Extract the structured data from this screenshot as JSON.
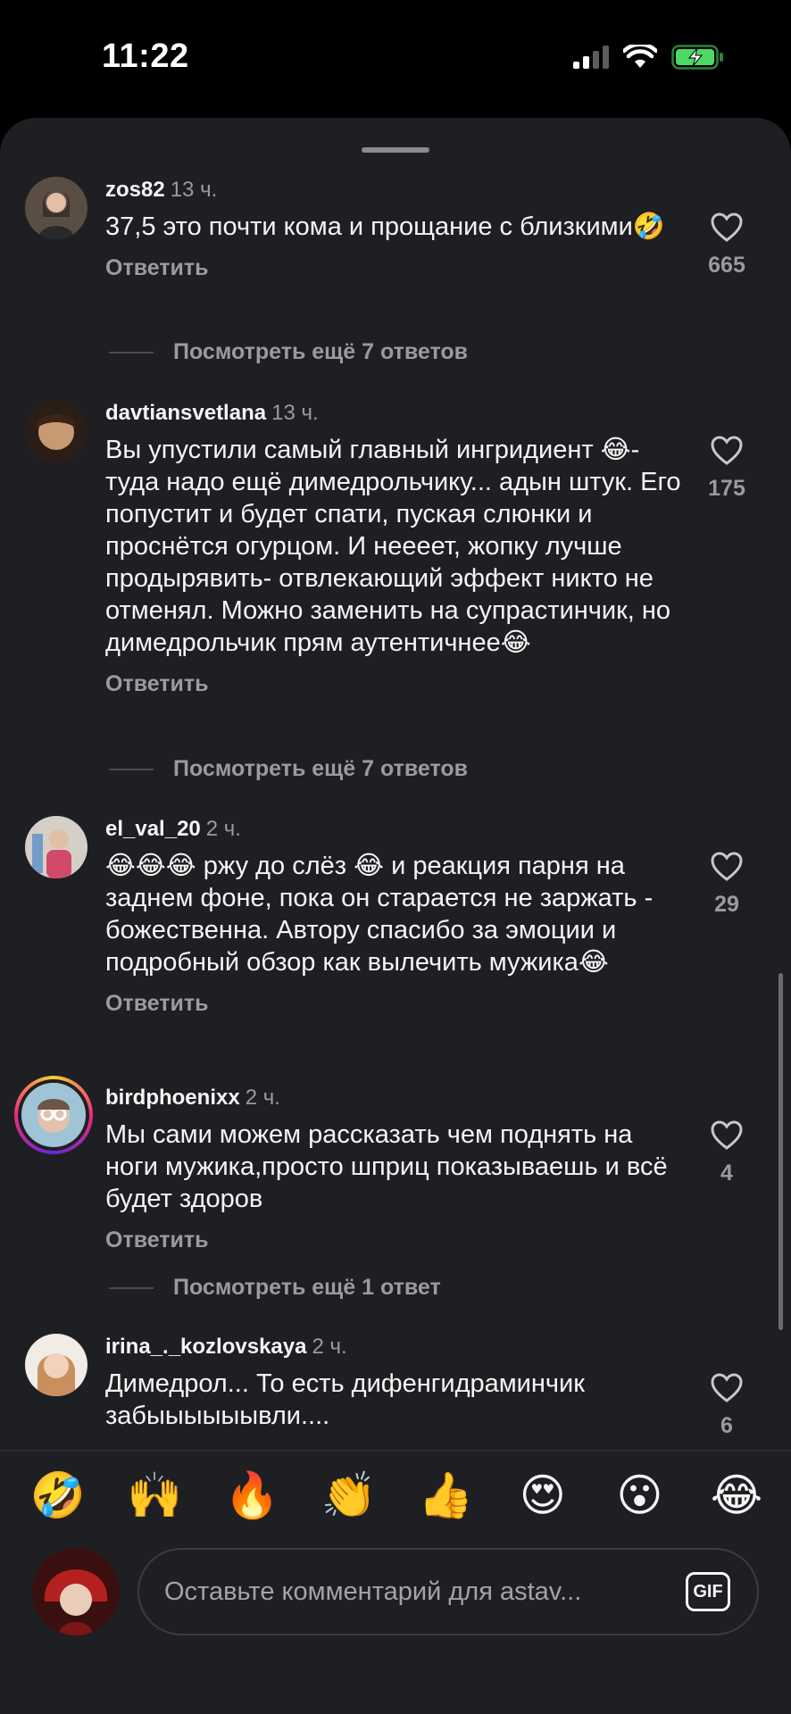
{
  "status_bar": {
    "time": "11:22"
  },
  "comments": [
    {
      "user": "zos82",
      "time": "13 ч.",
      "text": "37,5 это почти кома и прощание с близкими🤣",
      "reply_label": "Ответить",
      "likes": "665",
      "more_replies": "Посмотреть ещё 7 ответов",
      "avatar_color": "#7a6a5c"
    },
    {
      "user": "davtiansvetlana",
      "time": "13 ч.",
      "text": "Вы упустили самый главный ингридиент 😂- туда надо ещё димедрольчику... адын штук. Его попустит и будет спати, пуская слюнки и проснётся огурцом. И неееет, жопку лучше продырявить- отвлекающий эффект никто не отменял. Можно заменить на супрастинчик, но димедрольчик прям аутентичнее😂",
      "reply_label": "Ответить",
      "likes": "175",
      "more_replies": "Посмотреть ещё 7 ответов",
      "avatar_color": "#a5805f"
    },
    {
      "user": "el_val_20",
      "time": "2 ч.",
      "text": "😂😂😂 ржу до слёз 😂 и реакция парня на заднем фоне, пока он старается не заржать - божественна. Автору спасибо за эмоции и подробный обзор как вылечить мужика😂",
      "reply_label": "Ответить",
      "likes": "29",
      "avatar_color": "#c7b2a4"
    },
    {
      "user": "birdphoenixx",
      "time": "2 ч.",
      "text": "Мы сами можем рассказать чем поднять на ноги мужика,просто шприц показываешь и всё будет здоров",
      "reply_label": "Ответить",
      "likes": "4",
      "more_replies": "Посмотреть ещё 1 ответ",
      "avatar_color": "#b69a8a"
    },
    {
      "user": "irina_._kozlovskaya",
      "time": "2 ч.",
      "text": "Димедрол... То есть дифенгидраминчик забыыыыыывли....",
      "likes": "6",
      "avatar_color": "#d8b79a"
    }
  ],
  "emoji_bar": [
    "🤣",
    "🙌",
    "🔥",
    "👏",
    "👍",
    "😍",
    "😮",
    "😂"
  ],
  "composer": {
    "placeholder": "Оставьте комментарий для astav...",
    "gif_label": "GIF",
    "avatar_color": "#8c1f1f"
  },
  "colors": {
    "background": "#1e1f22",
    "secondary_text": "#9a9ba0",
    "battery": "#4cd964"
  }
}
